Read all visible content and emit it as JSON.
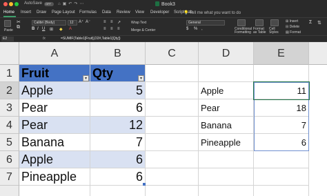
{
  "titlebar": {
    "autosave_label": "AutoSave",
    "autosave_state": "OFF",
    "title": "Book3"
  },
  "tabs": [
    "Home",
    "Insert",
    "Draw",
    "Page Layout",
    "Formulas",
    "Data",
    "Review",
    "View",
    "Developer",
    "Script Lab"
  ],
  "tell_me": "Tell me what you want to do",
  "ribbon": {
    "paste": "Paste",
    "font_name": "Calibri (Body)",
    "font_size": "12",
    "wrap_text": "Wrap Text",
    "merge_center": "Merge & Center",
    "number_format": "General",
    "conditional_formatting": "Conditional Formatting",
    "format_as_table": "Format as Table",
    "cell_styles": "Cell Styles",
    "insert": "Insert",
    "delete": "Delete",
    "format": "Format"
  },
  "formula_bar": {
    "name_box": "E2",
    "fx": "fx",
    "formula": "=SUMIF(Table1[Fruit],D2#,Table1[Qty])"
  },
  "grid": {
    "columns": [
      "A",
      "B",
      "C",
      "D",
      "E"
    ],
    "rows": [
      "1",
      "2",
      "3",
      "4",
      "5",
      "6",
      "7"
    ],
    "table_headers": [
      "Fruit",
      "Qty"
    ],
    "table_rows": [
      {
        "fruit": "Apple",
        "qty": "5"
      },
      {
        "fruit": "Pear",
        "qty": "6"
      },
      {
        "fruit": "Pear",
        "qty": "12"
      },
      {
        "fruit": "Banana",
        "qty": "7"
      },
      {
        "fruit": "Apple",
        "qty": "6"
      },
      {
        "fruit": "Pineapple",
        "qty": "6"
      }
    ],
    "summary_rows": [
      {
        "fruit": "Apple",
        "total": "11"
      },
      {
        "fruit": "Pear",
        "total": "18"
      },
      {
        "fruit": "Banana",
        "total": "7"
      },
      {
        "fruit": "Pineapple",
        "total": "6"
      }
    ]
  },
  "colors": {
    "table_header": "#4472c4",
    "band": "#d9e1f2",
    "selection": "#217346"
  }
}
